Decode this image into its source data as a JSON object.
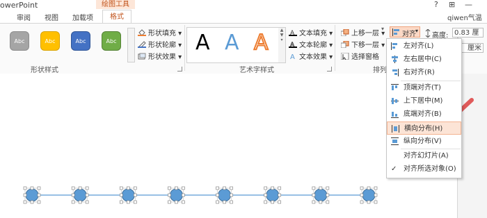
{
  "titlebar": {
    "app_title": "owerPoint",
    "tools_title": "绘图工具",
    "help": "?",
    "restore": "⊞",
    "minimize": "—"
  },
  "tabs": [
    {
      "label": "审阅"
    },
    {
      "label": "视图"
    },
    {
      "label": "加载项"
    },
    {
      "label": "格式",
      "active": true
    }
  ],
  "user_name": "qiwen气温",
  "shape_styles": {
    "group_label": "形状样式",
    "swatches": [
      {
        "label": "Abc",
        "color": "#a5a5a5",
        "border": "#8c8c8c"
      },
      {
        "label": "Abc",
        "color": "#ffc000",
        "border": "#d9a300"
      },
      {
        "label": "Abc",
        "color": "#4472c4",
        "border": "#2f5597"
      },
      {
        "label": "Abc",
        "color": "#70ad47",
        "border": "#548235"
      }
    ],
    "commands": [
      {
        "label": "形状填充",
        "icon": "paint-bucket-icon"
      },
      {
        "label": "形状轮廓",
        "icon": "pen-outline-icon"
      },
      {
        "label": "形状效果",
        "icon": "shape-effects-icon"
      }
    ]
  },
  "wordart": {
    "group_label": "艺术字样式",
    "samples": [
      {
        "label": "A",
        "color": "#000000"
      },
      {
        "label": "A",
        "color": "#5b9bd5"
      },
      {
        "label": "A",
        "color": "#ed7d31"
      }
    ],
    "commands": [
      {
        "label": "文本填充",
        "icon": "text-fill-icon"
      },
      {
        "label": "文本轮廓",
        "icon": "text-outline-icon"
      },
      {
        "label": "文本效果",
        "icon": "text-effects-icon"
      }
    ]
  },
  "arrange": {
    "group_label": "排列",
    "commands": [
      {
        "label": "上移一层",
        "icon": "bring-forward-icon"
      },
      {
        "label": "下移一层",
        "icon": "send-backward-icon"
      },
      {
        "label": "选择窗格",
        "icon": "selection-pane-icon"
      }
    ],
    "align_label": "对齐"
  },
  "size": {
    "height_label": "高度:",
    "height_value": "0.83 厘米",
    "width_value": "厘米"
  },
  "align_menu": {
    "items": [
      {
        "label": "左对齐(L)",
        "icon": "align-left-icon"
      },
      {
        "label": "左右居中(C)",
        "icon": "align-center-icon"
      },
      {
        "label": "右对齐(R)",
        "icon": "align-right-icon"
      },
      {
        "label": "顶端对齐(T)",
        "icon": "align-top-icon"
      },
      {
        "label": "上下居中(M)",
        "icon": "align-middle-icon"
      },
      {
        "label": "底端对齐(B)",
        "icon": "align-bottom-icon"
      },
      {
        "label": "横向分布(H)",
        "icon": "distribute-horizontal-icon",
        "highlighted": true
      },
      {
        "label": "纵向分布(V)",
        "icon": "distribute-vertical-icon"
      },
      {
        "label": "对齐幻灯片(A)",
        "icon": ""
      },
      {
        "label": "对齐所选对象(O)",
        "icon": "check-icon",
        "checked": true
      }
    ]
  },
  "canvas": {
    "shape_count": 8,
    "shape_color": "#5b9bd5",
    "annotation_arrow_color": "#e05a5a"
  },
  "colors": {
    "accent": "#c1531b",
    "highlight": "#fce4d6"
  }
}
